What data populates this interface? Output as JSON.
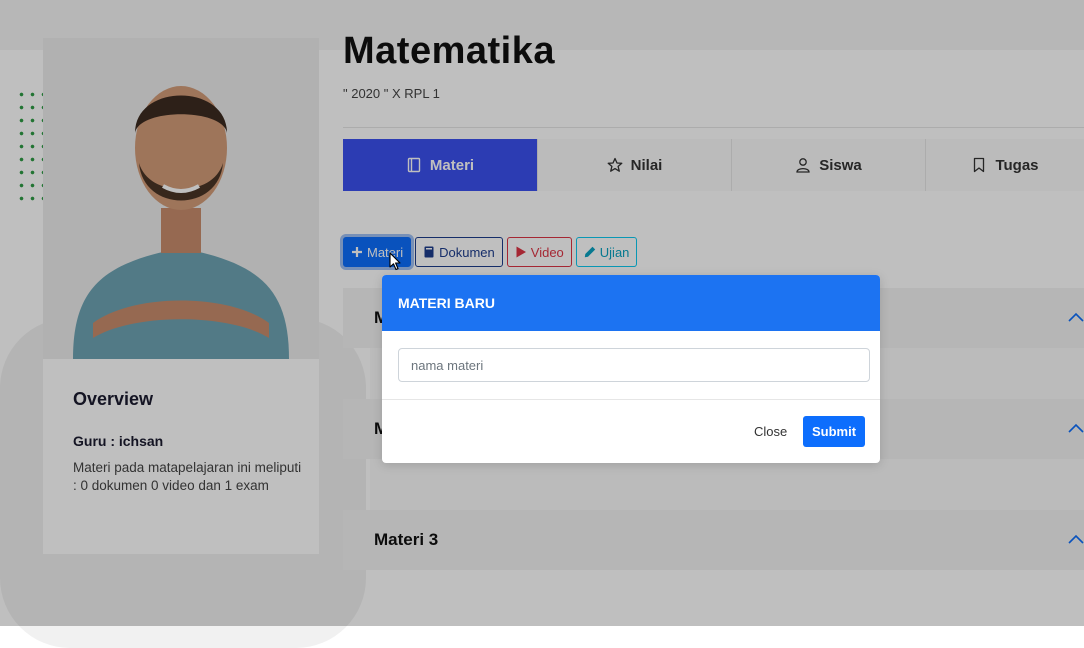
{
  "course": {
    "title": "Matematika",
    "subtitle": "\" 2020 \" X RPL 1"
  },
  "tabs": [
    {
      "label": "Materi",
      "icon": "book-icon",
      "active": true
    },
    {
      "label": "Nilai",
      "icon": "star-icon"
    },
    {
      "label": "Siswa",
      "icon": "user-icon"
    },
    {
      "label": "Tugas",
      "icon": "bookmark-icon"
    }
  ],
  "actions": [
    {
      "label": "Materi",
      "icon": "plus-icon"
    },
    {
      "label": "Dokumen",
      "icon": "book-icon"
    },
    {
      "label": "Video",
      "icon": "play-icon"
    },
    {
      "label": "Ujian",
      "icon": "pencil-icon"
    }
  ],
  "overview": {
    "heading": "Overview",
    "teacher": "Guru : ichsan",
    "description": "Materi pada matapelajaran ini meliputi : 0 dokumen 0 video dan 1 exam"
  },
  "accordion": [
    {
      "label": "M"
    },
    {
      "label": "M"
    },
    {
      "label": "Materi 3"
    }
  ],
  "modal": {
    "title": "MATERI BARU",
    "input_placeholder": "nama materi",
    "close_label": "Close",
    "submit_label": "Submit"
  },
  "colors": {
    "accent": "#3b50ef",
    "primary": "#0d6efd",
    "modal_header": "#1c73f2",
    "danger": "#dc3545",
    "info": "#0dcaf0"
  }
}
